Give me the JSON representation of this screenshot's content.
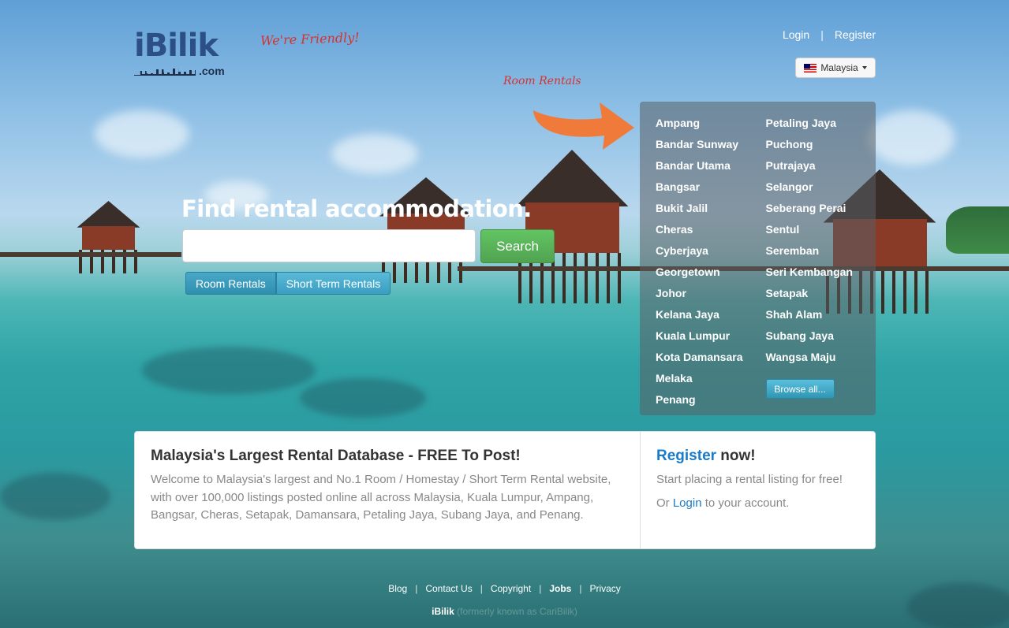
{
  "header": {
    "logo_text": "iBilik",
    "logo_suffix": ".com",
    "tagline": "We're Friendly!",
    "login_label": "Login",
    "register_label": "Register",
    "separator": "|",
    "country": "Malaysia"
  },
  "annotation": {
    "room_rentals_note": "Room Rentals"
  },
  "locations": {
    "col1": [
      "Ampang",
      "Bandar Sunway",
      "Bandar Utama",
      "Bangsar",
      "Bukit Jalil",
      "Cheras",
      "Cyberjaya",
      "Georgetown",
      "Johor",
      "Kelana Jaya",
      "Kuala Lumpur",
      "Kota Damansara",
      "Melaka",
      "Penang"
    ],
    "col2": [
      "Petaling Jaya",
      "Puchong",
      "Putrajaya",
      "Selangor",
      "Seberang Perai",
      "Sentul",
      "Seremban",
      "Seri Kembangan",
      "Setapak",
      "Shah Alam",
      "Subang Jaya",
      "Wangsa Maju"
    ],
    "browse_label": "Browse all..."
  },
  "search": {
    "headline": "Find rental accommodation.",
    "input_value": "",
    "button_label": "Search",
    "tabs": [
      "Room Rentals",
      "Short Term Rentals"
    ]
  },
  "info": {
    "title": "Malaysia's Largest Rental Database - FREE To Post!",
    "description": "Welcome to Malaysia's largest and No.1 Room / Homestay / Short Term Rental website, with over 100,000 listings posted online all across Malaysia, Kuala Lumpur, Ampang, Bangsar, Cheras, Setapak, Damansara, Petaling Jaya, Subang Jaya, and Penang.",
    "register_link": "Register",
    "register_suffix": " now!",
    "register_text": "Start placing a rental listing for free!",
    "login_prefix": "Or ",
    "login_link": "Login",
    "login_suffix": " to your account."
  },
  "footer": {
    "links": [
      "Blog",
      "Contact Us",
      "Copyright",
      "Jobs",
      "Privacy"
    ],
    "copy_brand": "iBilik",
    "copy_faint": "(formerly known as CariBilik)"
  },
  "colors": {
    "accent_green": "#5cb85c",
    "accent_blue": "#2f96b4",
    "link_blue": "#1a7bc9",
    "annotation_red": "#d8322f"
  }
}
